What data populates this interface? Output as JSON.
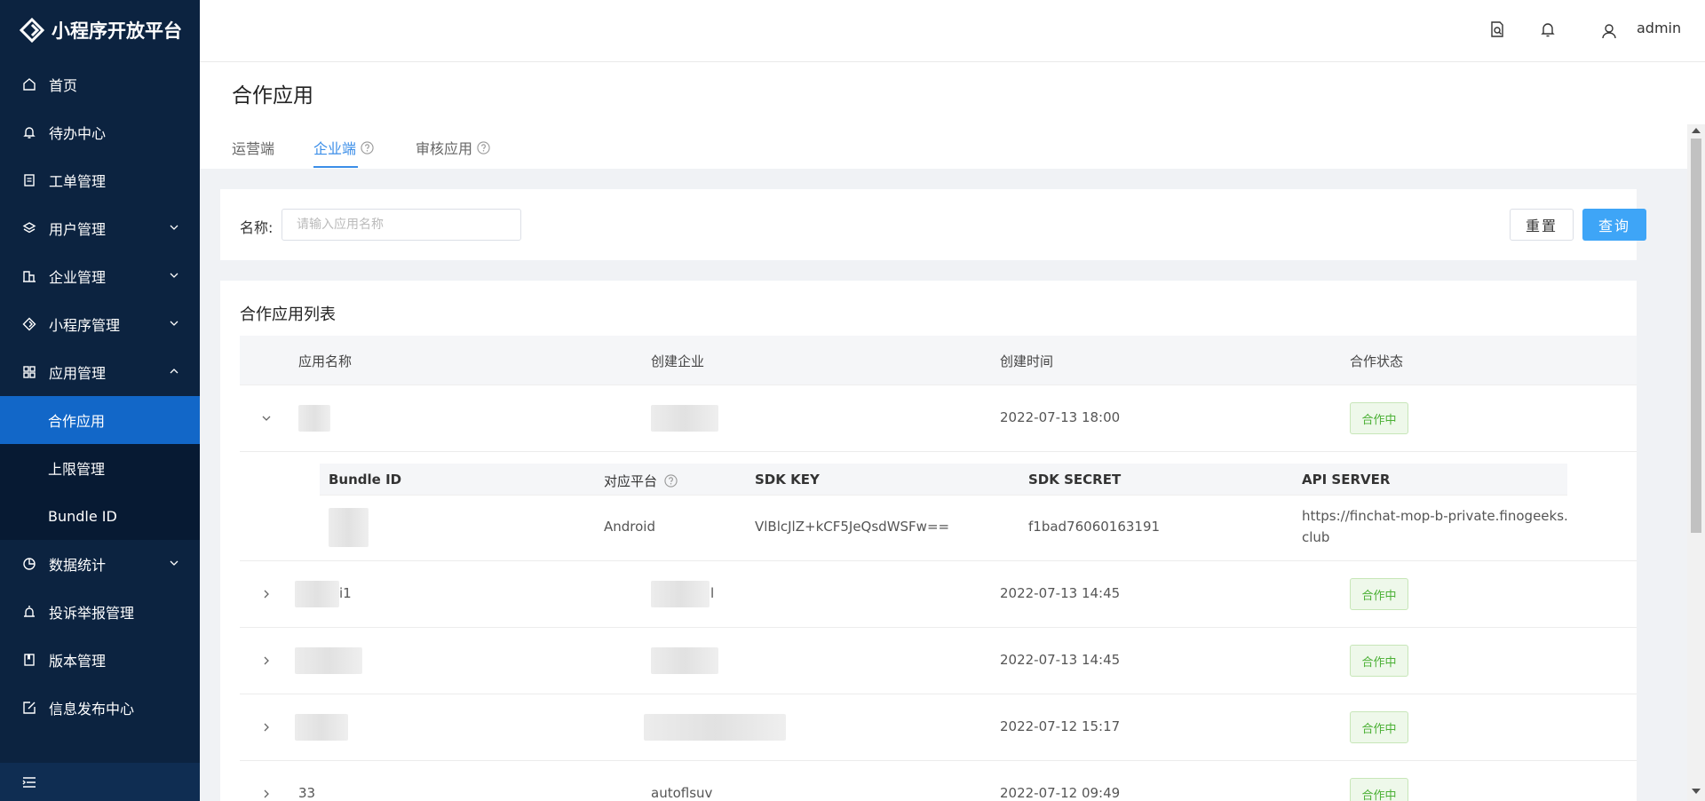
{
  "app": {
    "title": "小程序开放平台"
  },
  "sidebar": {
    "items": [
      {
        "label": "首页",
        "icon": "home-icon"
      },
      {
        "label": "待办中心",
        "icon": "bell-icon"
      },
      {
        "label": "工单管理",
        "icon": "clipboard-icon"
      },
      {
        "label": "用户管理",
        "icon": "layers-icon",
        "expandable": true
      },
      {
        "label": "企业管理",
        "icon": "building-icon",
        "expandable": true
      },
      {
        "label": "小程序管理",
        "icon": "diamond-icon",
        "expandable": true
      },
      {
        "label": "应用管理",
        "icon": "grid-icon",
        "expandable": true,
        "expanded": true
      }
    ],
    "sub_items": [
      {
        "label": "合作应用",
        "active": true
      },
      {
        "label": "上限管理"
      },
      {
        "label": "Bundle ID"
      }
    ],
    "items_after": [
      {
        "label": "数据统计",
        "icon": "pie-chart-icon",
        "expandable": true
      },
      {
        "label": "投诉举报管理",
        "icon": "alarm-icon"
      },
      {
        "label": "版本管理",
        "icon": "book-icon"
      },
      {
        "label": "信息发布中心",
        "icon": "edit-icon"
      }
    ]
  },
  "header": {
    "user": "admin"
  },
  "page": {
    "title": "合作应用",
    "tabs": [
      {
        "label": "运营端",
        "active": false,
        "help": false
      },
      {
        "label": "企业端",
        "active": true,
        "help": true
      },
      {
        "label": "审核应用",
        "active": false,
        "help": true
      }
    ]
  },
  "filter": {
    "name_label": "名称:",
    "name_placeholder": "请输入应用名称",
    "reset_label": "重置",
    "query_label": "查询"
  },
  "list": {
    "title": "合作应用列表",
    "columns": [
      "应用名称",
      "创建企业",
      "创建时间",
      "合作状态"
    ],
    "rows": [
      {
        "name": "",
        "company": "",
        "created": "2022-07-13 18:00",
        "status": "合作中",
        "expanded": true
      },
      {
        "name": "i1",
        "company": "l",
        "created": "2022-07-13 14:45",
        "status": "合作中",
        "expanded": false
      },
      {
        "name": "",
        "company": "",
        "created": "2022-07-13 14:45",
        "status": "合作中",
        "expanded": false
      },
      {
        "name": "",
        "company": "",
        "created": "2022-07-12 15:17",
        "status": "合作中",
        "expanded": false
      },
      {
        "name": "33",
        "company": "autoflsuv",
        "created": "2022-07-12 09:49",
        "status": "合作中",
        "expanded": false
      }
    ],
    "detail": {
      "columns": [
        "Bundle ID",
        "对应平台",
        "SDK KEY",
        "SDK SECRET",
        "API SERVER"
      ],
      "row": {
        "bundle_id": "",
        "platform": "Android",
        "sdk_key": "VlBlcJlZ+kCF5JeQsdWSFw==",
        "sdk_secret": "f1bad76060163191",
        "api_server_line1": "https://finchat-mop-b-private.finogeeks.",
        "api_server_line2": "club"
      }
    }
  },
  "colors": {
    "sidebar_bg": "#0c2340",
    "active_item": "#1267c8",
    "primary": "#3ea5f7",
    "tab_active": "#3b8ee8",
    "status_green": "#4bb035"
  }
}
